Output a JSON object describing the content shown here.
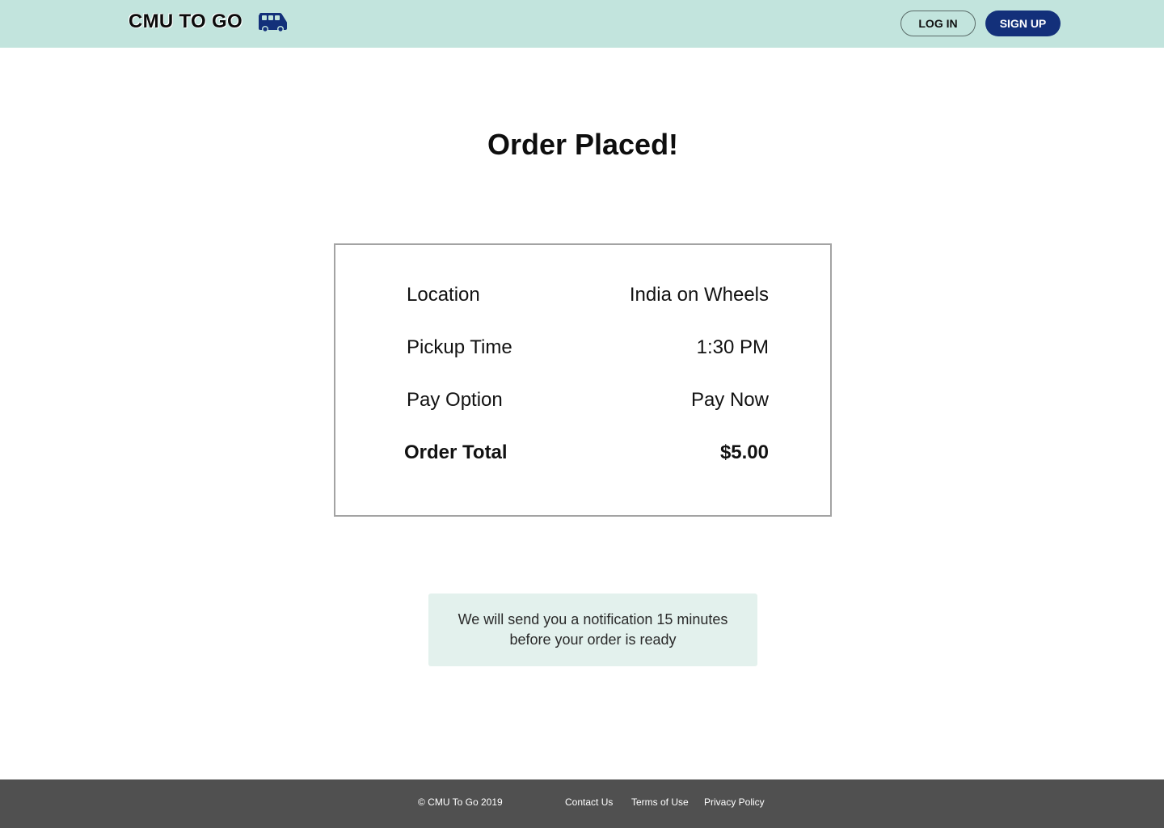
{
  "header": {
    "brand": "CMU TO GO",
    "brand_icon": "van-icon",
    "login_label": "LOG IN",
    "signup_label": "SIGN UP",
    "colors": {
      "bar": "#c2e4dd",
      "signup_bg": "#13307a",
      "icon": "#13307a"
    }
  },
  "main": {
    "title": "Order Placed!",
    "order": {
      "rows": [
        {
          "label": "Location",
          "value": "India on Wheels"
        },
        {
          "label": "Pickup Time",
          "value": "1:30 PM"
        },
        {
          "label": "Pay Option",
          "value": "Pay Now"
        }
      ],
      "total": {
        "label": "Order Total",
        "value": "$5.00"
      }
    },
    "notice": "We will send you a notification 15 minutes before your order is ready",
    "notice_bg": "#e3f1ed"
  },
  "footer": {
    "copyright": "© CMU To Go 2019",
    "links": [
      "Contact Us",
      "Terms of Use",
      "Privacy Policy"
    ],
    "bg": "#505050"
  }
}
